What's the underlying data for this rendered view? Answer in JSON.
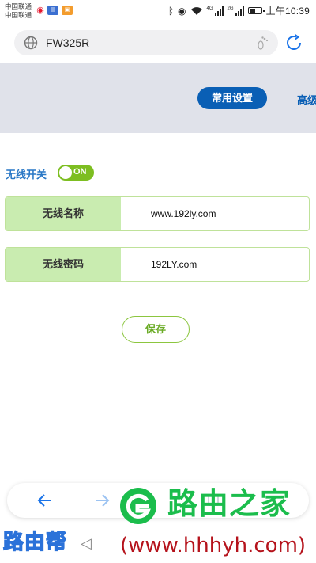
{
  "status_bar": {
    "carrier_1": "中国联通",
    "carrier_2": "中国联通",
    "net_label_1": "4G",
    "net_label_2": "2G",
    "time": "上午10:39",
    "battery_level": 0.55,
    "icons": [
      "weibo-icon",
      "news-app-icon",
      "app-icon",
      "bluetooth-icon",
      "eye-icon",
      "wifi-icon",
      "signal-icon",
      "battery-icon"
    ]
  },
  "browser": {
    "url": "FW325R",
    "icons": [
      "globe-icon",
      "footprint-icon",
      "refresh-icon"
    ]
  },
  "header": {
    "active_tab": "常用设置",
    "next_tab": "高级"
  },
  "wireless": {
    "switch_label": "无线开关",
    "switch_state": "ON",
    "name_label": "无线名称",
    "name_value": "www.192ly.com",
    "password_label": "无线密码",
    "password_value": "192LY.com",
    "save_label": "保存"
  },
  "nav": {
    "icons": [
      "back-arrow-icon",
      "forward-arrow-icon",
      "tabs-icon"
    ]
  },
  "watermark": {
    "brand": "路由之家",
    "url": "(www.hhhyh.com)",
    "left_brand": "路由帮"
  },
  "colors": {
    "accent_blue": "#0a5fb5",
    "green": "#7dbe21",
    "label_bg": "#c9ecb0",
    "band_bg": "#e0e2ea",
    "watermark_green": "#1bbd4c",
    "watermark_red": "#b5121b"
  }
}
